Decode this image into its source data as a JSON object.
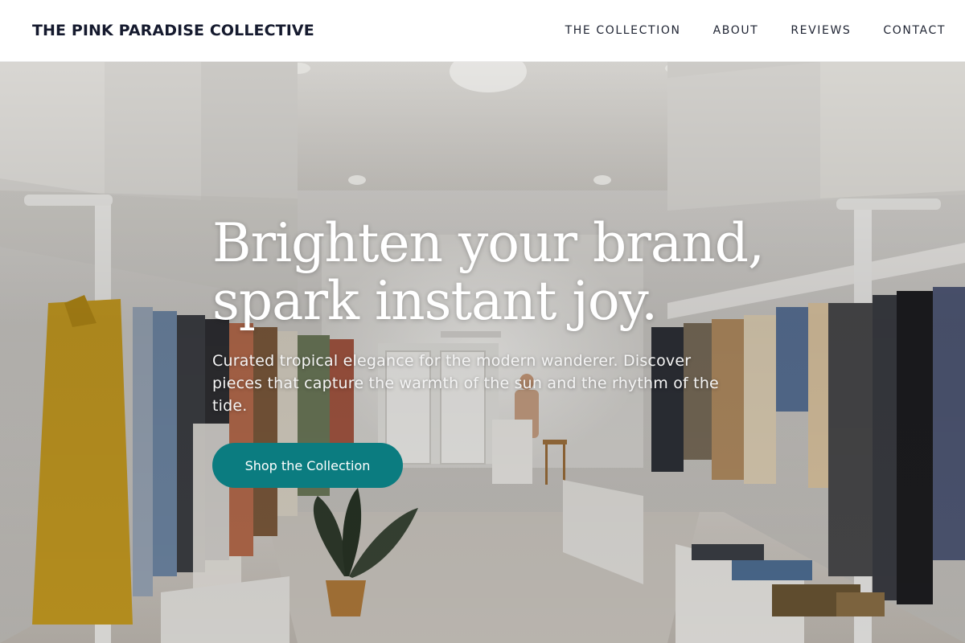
{
  "header": {
    "brand": "THE PINK PARADISE COLLECTIVE",
    "nav": [
      {
        "label": "THE COLLECTION"
      },
      {
        "label": "ABOUT"
      },
      {
        "label": "REVIEWS"
      },
      {
        "label": "CONTACT"
      }
    ]
  },
  "hero": {
    "headline_line1": "Brighten your brand,",
    "headline_line2": "spark instant joy.",
    "tagline": "Curated tropical elegance for the modern wanderer. Discover pieces that capture the warmth of the sun and the rhythm of the tide.",
    "cta_label": "Shop the Collection",
    "image": "boutique-interior-photo"
  },
  "colors": {
    "accent": "#0b7c80",
    "brand_text": "#151a2e",
    "header_bg": "#ffffff"
  }
}
